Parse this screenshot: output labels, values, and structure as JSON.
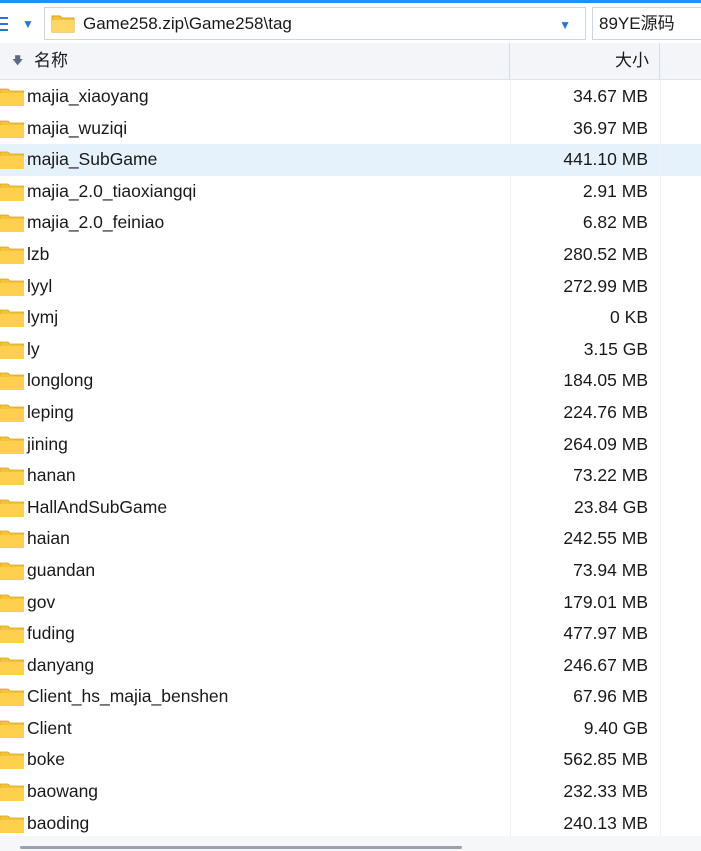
{
  "address": {
    "path": "Game258.zip\\Game258\\tag",
    "search_text": "89YE源码",
    "menu_icon": "menu-icon",
    "history_icon": "chevron-down-icon",
    "dropdown_icon": "chevron-down-icon",
    "folder_icon": "folder-icon"
  },
  "columns": {
    "name": "名称",
    "size": "大小",
    "sort_icon": "sort-down-arrow-icon"
  },
  "colors": {
    "accent": "#1e90ff",
    "folder": "#f5c339",
    "selected_row": "#e5f1fb"
  },
  "files": [
    {
      "name": "majia_xiaoyang",
      "size": "34.67 MB"
    },
    {
      "name": "majia_wuziqi",
      "size": "36.97 MB"
    },
    {
      "name": "majia_SubGame",
      "size": "441.10 MB",
      "selected": true
    },
    {
      "name": "majia_2.0_tiaoxiangqi",
      "size": "2.91 MB"
    },
    {
      "name": "majia_2.0_feiniao",
      "size": "6.82 MB"
    },
    {
      "name": "lzb",
      "size": "280.52 MB"
    },
    {
      "name": "lyyl",
      "size": "272.99 MB"
    },
    {
      "name": "lymj",
      "size": "0 KB"
    },
    {
      "name": "ly",
      "size": "3.15 GB"
    },
    {
      "name": "longlong",
      "size": "184.05 MB"
    },
    {
      "name": "leping",
      "size": "224.76 MB"
    },
    {
      "name": "jining",
      "size": "264.09 MB"
    },
    {
      "name": "hanan",
      "size": "73.22 MB"
    },
    {
      "name": "HallAndSubGame",
      "size": "23.84 GB"
    },
    {
      "name": "haian",
      "size": "242.55 MB"
    },
    {
      "name": "guandan",
      "size": "73.94 MB"
    },
    {
      "name": "gov",
      "size": "179.01 MB"
    },
    {
      "name": "fuding",
      "size": "477.97 MB"
    },
    {
      "name": "danyang",
      "size": "246.67 MB"
    },
    {
      "name": "Client_hs_majia_benshen",
      "size": "67.96 MB"
    },
    {
      "name": "Client",
      "size": "9.40 GB"
    },
    {
      "name": "boke",
      "size": "562.85 MB"
    },
    {
      "name": "baowang",
      "size": "232.33 MB"
    },
    {
      "name": "baoding",
      "size": "240.13 MB"
    }
  ]
}
